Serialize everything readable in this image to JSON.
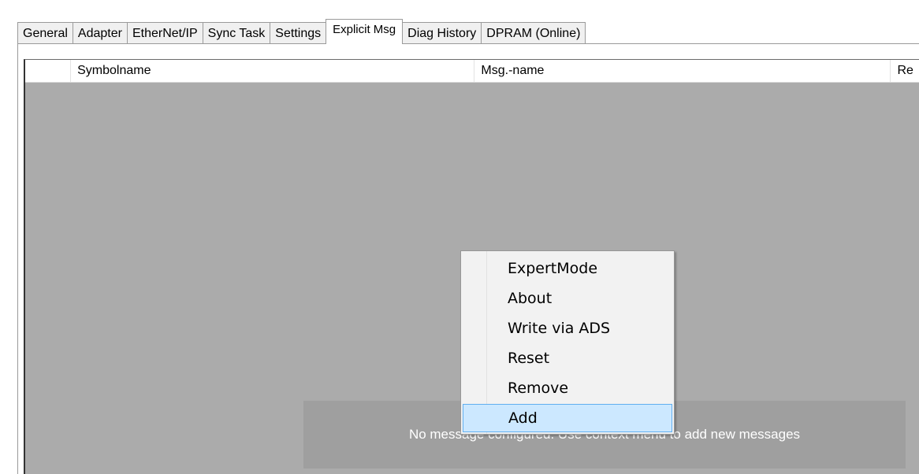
{
  "tabs": [
    {
      "label": "General"
    },
    {
      "label": "Adapter"
    },
    {
      "label": "EtherNet/IP"
    },
    {
      "label": "Sync Task"
    },
    {
      "label": "Settings"
    },
    {
      "label": "Explicit Msg"
    },
    {
      "label": "Diag History"
    },
    {
      "label": "DPRAM (Online)"
    }
  ],
  "active_tab": "Explicit Msg",
  "grid": {
    "columns": [
      {
        "label": ""
      },
      {
        "label": "Symbolname"
      },
      {
        "label": "Msg.-name"
      },
      {
        "label": "Re"
      }
    ],
    "empty_text": "No message configured. Use context menu to add new messages"
  },
  "context_menu": {
    "items": [
      {
        "label": "ExpertMode"
      },
      {
        "label": "About"
      },
      {
        "label": "Write via ADS"
      },
      {
        "label": "Reset"
      },
      {
        "label": "Remove"
      },
      {
        "label": "Add"
      }
    ],
    "highlighted": "Add"
  },
  "colors": {
    "grid_background": "#ababab",
    "banner_background": "#9f9f9f",
    "menu_highlight": "#cce8ff",
    "menu_highlight_border": "#60aef0"
  }
}
